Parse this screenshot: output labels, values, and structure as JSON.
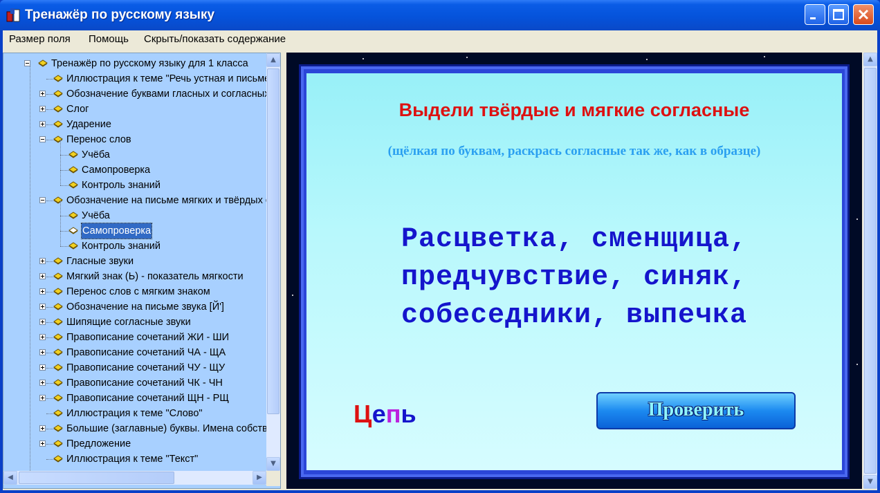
{
  "window": {
    "title": "Тренажёр по русскому языку"
  },
  "menu": {
    "items": [
      "Размер поля",
      "Помощь",
      "Скрыть/показать содержание"
    ]
  },
  "tree": {
    "items": [
      {
        "label": "Тренажёр по русскому языку для 1 класса",
        "level": 0,
        "expander": "minus"
      },
      {
        "label": "Иллюстрация к теме \"Речь устная и письменная\"",
        "level": 1,
        "expander": "none"
      },
      {
        "label": "Обозначение буквами гласных и согласных звуков",
        "level": 1,
        "expander": "plus"
      },
      {
        "label": "Слог",
        "level": 1,
        "expander": "plus"
      },
      {
        "label": "Ударение",
        "level": 1,
        "expander": "plus"
      },
      {
        "label": "Перенос слов",
        "level": 1,
        "expander": "minus"
      },
      {
        "label": "Учёба",
        "level": 2,
        "expander": "none"
      },
      {
        "label": "Самопроверка",
        "level": 2,
        "expander": "none"
      },
      {
        "label": "Контроль знаний",
        "level": 2,
        "expander": "none"
      },
      {
        "label": "Обозначение на письме мягких и твёрдых согласных",
        "level": 1,
        "expander": "minus"
      },
      {
        "label": "Учёба",
        "level": 2,
        "expander": "none"
      },
      {
        "label": "Самопроверка",
        "level": 2,
        "expander": "none",
        "selected": true
      },
      {
        "label": "Контроль знаний",
        "level": 2,
        "expander": "none"
      },
      {
        "label": "Гласные звуки",
        "level": 1,
        "expander": "plus"
      },
      {
        "label": "Мягкий знак (Ь) - показатель мягкости",
        "level": 1,
        "expander": "plus"
      },
      {
        "label": "Перенос слов с мягким знаком",
        "level": 1,
        "expander": "plus"
      },
      {
        "label": "Обозначение на письме звука [Й']",
        "level": 1,
        "expander": "plus"
      },
      {
        "label": "Шипящие согласные звуки",
        "level": 1,
        "expander": "plus"
      },
      {
        "label": "Правописание сочетаний ЖИ - ШИ",
        "level": 1,
        "expander": "plus"
      },
      {
        "label": "Правописание сочетаний ЧА - ЩА",
        "level": 1,
        "expander": "plus"
      },
      {
        "label": "Правописание сочетаний ЧУ - ЩУ",
        "level": 1,
        "expander": "plus"
      },
      {
        "label": "Правописание сочетаний ЧК - ЧН",
        "level": 1,
        "expander": "plus"
      },
      {
        "label": "Правописание сочетаний ЩН - РЩ",
        "level": 1,
        "expander": "plus"
      },
      {
        "label": "Иллюстрация к теме \"Слово\"",
        "level": 1,
        "expander": "none"
      },
      {
        "label": "Большие (заглавные) буквы. Имена собственные",
        "level": 1,
        "expander": "plus"
      },
      {
        "label": "Предложение",
        "level": 1,
        "expander": "plus"
      },
      {
        "label": "Иллюстрация к теме \"Текст\"",
        "level": 1,
        "expander": "none"
      }
    ]
  },
  "exercise": {
    "title": "Выдели твёрдые и мягкие согласные",
    "hint": "(щёлкая по буквам, раскрась согласные так же, как в образце)",
    "lines": [
      "Расцветка, сменщица,",
      "предчувствие, синяк,",
      "собеседники, выпечка"
    ],
    "sample": [
      {
        "ch": "Ц",
        "color": "#dd1111"
      },
      {
        "ch": "е",
        "color": "#1515cc"
      },
      {
        "ch": "п",
        "color": "#bb22dd"
      },
      {
        "ch": "ь",
        "color": "#1515cc"
      }
    ],
    "check_button": "Проверить"
  },
  "colors": {
    "hard": "#dd1111",
    "soft": "#bb22dd",
    "vowel": "#1515cc",
    "title": "#dd1111",
    "hint": "#2ba0f0"
  }
}
